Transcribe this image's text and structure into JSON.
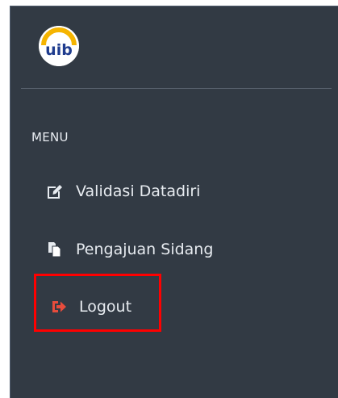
{
  "brand": {
    "logo_text": "uib"
  },
  "sidebar": {
    "menu_header": "MENU",
    "items": [
      {
        "label": "Validasi Datadiri",
        "icon": "edit-icon"
      },
      {
        "label": "Pengajuan Sidang",
        "icon": "files-icon"
      },
      {
        "label": "Logout",
        "icon": "logout-icon",
        "highlighted": true
      }
    ]
  },
  "colors": {
    "sidebar_bg": "#323a44",
    "text": "#e7ebf0",
    "logout_icon": "#e74c3c",
    "highlight_border": "#ff0000",
    "logo_blue": "#1f3c8e",
    "logo_gold": "#f5b400"
  }
}
